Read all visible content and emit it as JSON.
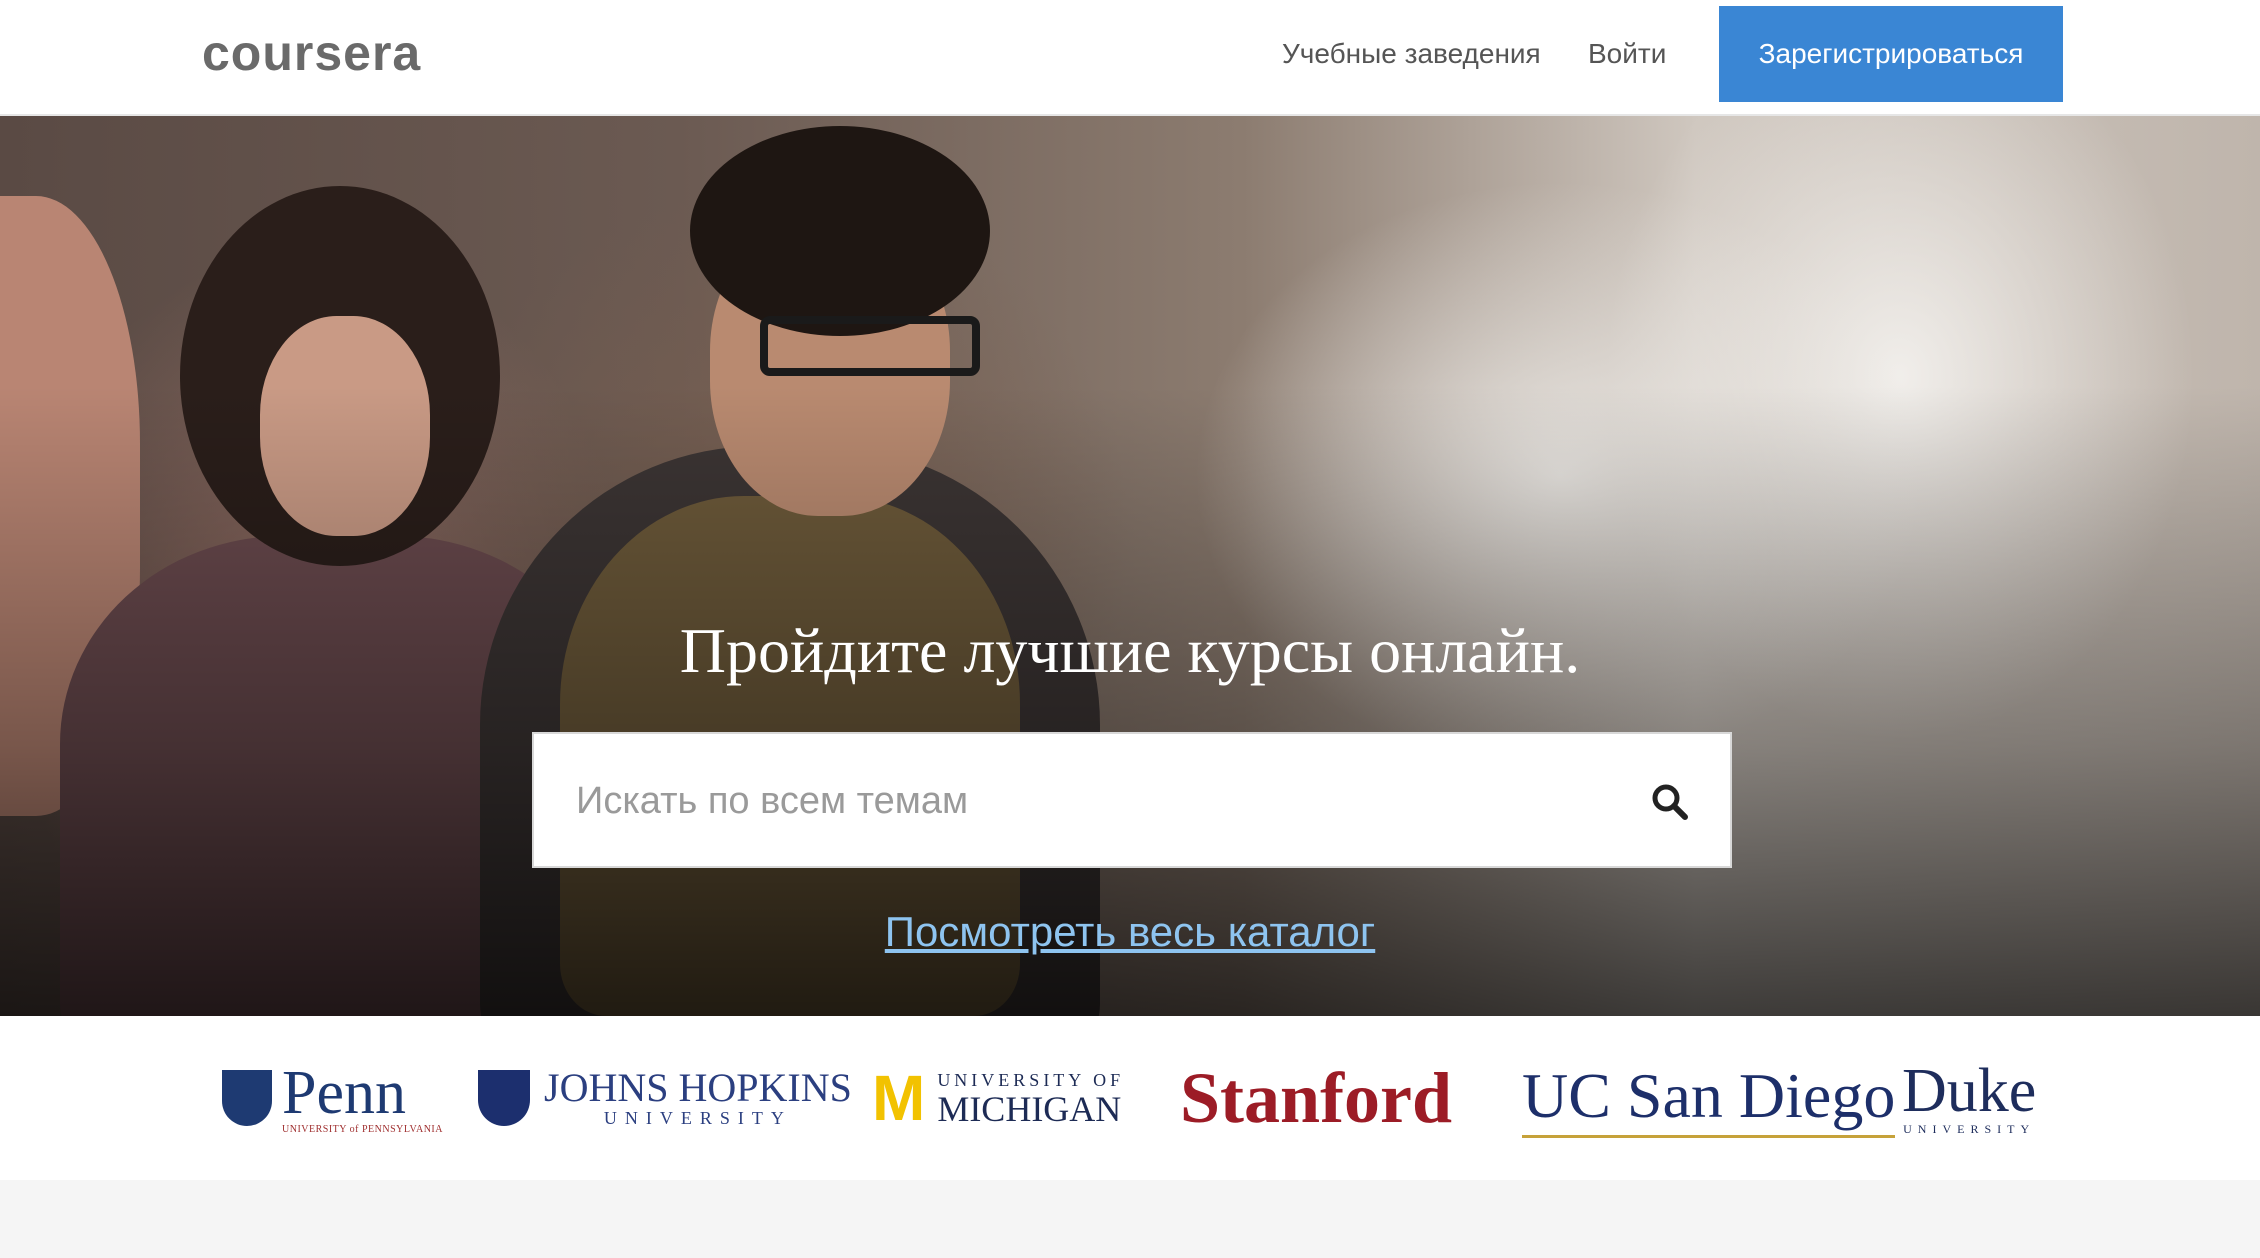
{
  "header": {
    "logo": "coursera",
    "nav": {
      "institutions": "Учебные заведения",
      "login": "Войти"
    },
    "signup_label": "Зарегистрироваться"
  },
  "hero": {
    "title": "Пройдите лучшие курсы онлайн.",
    "search_placeholder": "Искать по всем темам",
    "search_icon": "search-icon",
    "catalog_link": "Посмотреть весь каталог"
  },
  "partners": {
    "penn": {
      "name": "Penn",
      "sub": "UNIVERSITY of PENNSYLVANIA"
    },
    "jhu": {
      "name": "JOHNS HOPKINS",
      "sub": "UNIVERSITY"
    },
    "umich": {
      "mark": "M",
      "top": "UNIVERSITY OF",
      "name": "MICHIGAN"
    },
    "stanford": {
      "name": "Stanford"
    },
    "ucsd": {
      "name": "UC San Diego"
    },
    "duke": {
      "name": "Duke",
      "sub": "UNIVERSITY"
    }
  },
  "colors": {
    "accent": "#3a86d4",
    "link": "#8ec4f0",
    "stanford_red": "#9c1c26",
    "michigan_maize": "#f2c200"
  }
}
